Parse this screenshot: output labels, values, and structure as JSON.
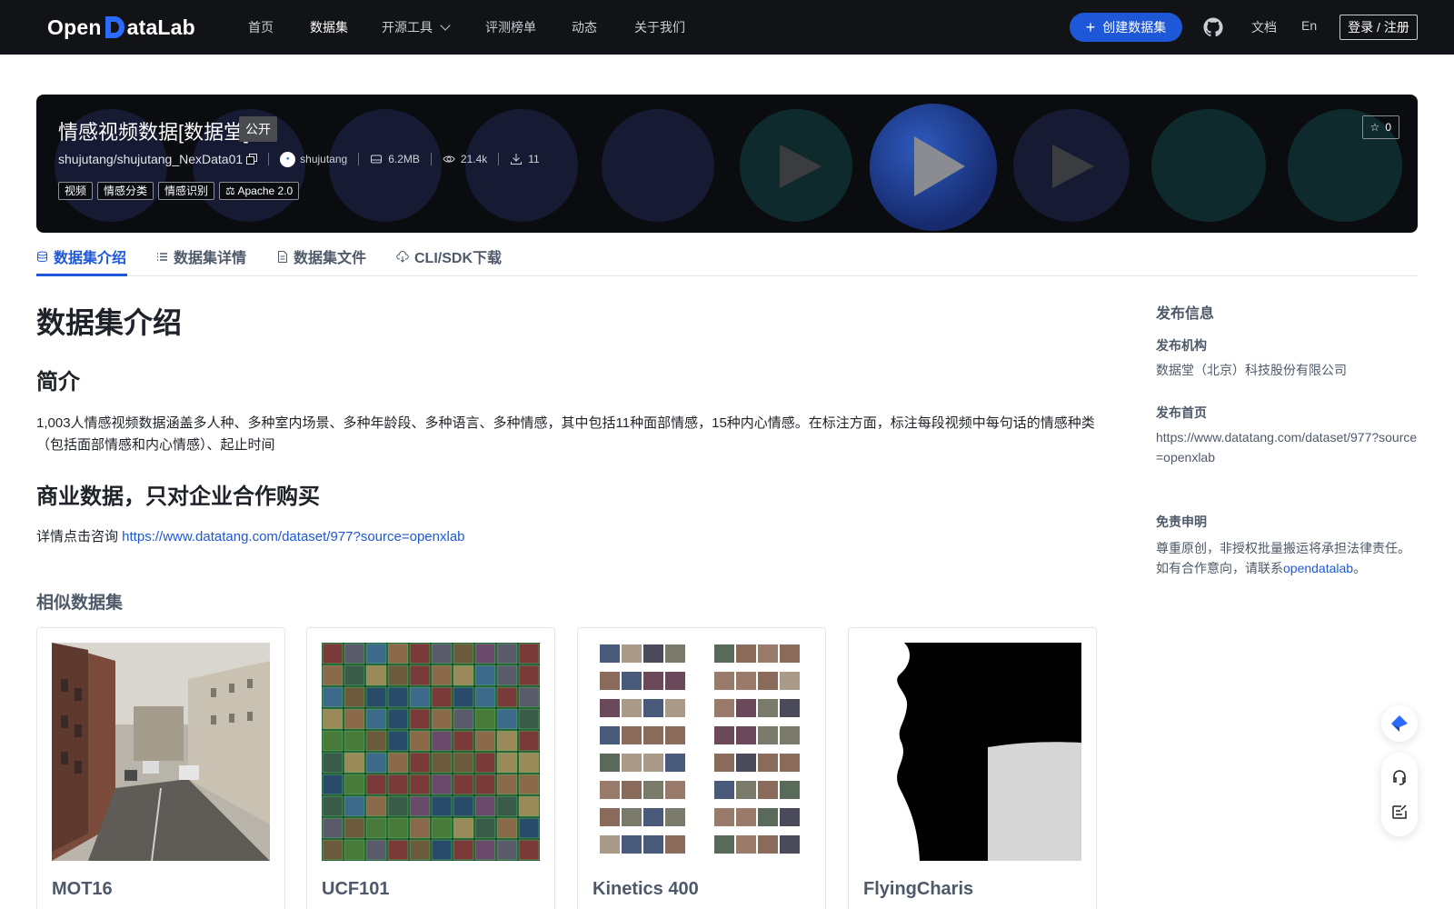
{
  "brand": {
    "logo_text_1": "Open",
    "logo_text_2": "ataLab"
  },
  "nav": {
    "items": [
      {
        "label": "首页"
      },
      {
        "label": "数据集"
      },
      {
        "label": "开源工具"
      },
      {
        "label": "评测榜单"
      },
      {
        "label": "动态"
      },
      {
        "label": "关于我们"
      }
    ],
    "active": "数据集",
    "create_label": "创建数据集",
    "docs_label": "文档",
    "lang_label": "En",
    "login_label": "登录 / 注册"
  },
  "dataset": {
    "title": "情感视频数据[数据堂]",
    "visibility": "公开",
    "repo_path": "shujutang/shujutang_NexData01",
    "owner": "shujutang",
    "size": "6.2MB",
    "views": "21.4k",
    "downloads": "11",
    "stars": "0",
    "tags": [
      "视频",
      "情感分类",
      "情感识别"
    ],
    "license": "Apache 2.0"
  },
  "tabs": [
    {
      "label": "数据集介绍",
      "icon": "database-icon"
    },
    {
      "label": "数据集详情",
      "icon": "list-icon"
    },
    {
      "label": "数据集文件",
      "icon": "file-icon"
    },
    {
      "label": "CLI/SDK下载",
      "icon": "cloud-download-icon"
    }
  ],
  "content": {
    "heading": "数据集介绍",
    "intro_title": "简介",
    "intro_text": "1,003人情感视频数据涵盖多人种、多种室内场景、多种年龄段、多种语言、多种情感，其中包括11种面部情感，15种内心情感。在标注方面，标注每段视频中每句话的情感种类（包括面部情感和内心情感）、起止时间",
    "commercial_title": "商业数据，只对企业合作购买",
    "consult_prefix": "详情点击咨询 ",
    "consult_link": "https://www.datatang.com/dataset/977?source=openxlab",
    "similar_title": "相似数据集",
    "similar": [
      {
        "name": "MOT16"
      },
      {
        "name": "UCF101"
      },
      {
        "name": "Kinetics 400"
      },
      {
        "name": "FlyingCharis"
      }
    ]
  },
  "sidebar": {
    "title": "发布信息",
    "org_label": "发布机构",
    "org_value": "数据堂（北京）科技股份有限公司",
    "home_label": "发布首页",
    "home_value": "https://www.datatang.com/dataset/977?source=openxlab",
    "disclaimer_label": "免责申明",
    "disclaimer_line1": "尊重原创，非授权批量搬运将承担法律责任。",
    "disclaimer_line2_prefix": "如有合作意向，请联系",
    "disclaimer_link": "opendatalab",
    "disclaimer_suffix": "。"
  },
  "colors": {
    "accent": "#1e58d8",
    "nav_bg": "#121316",
    "hero_bg": "#0b0c0f"
  }
}
